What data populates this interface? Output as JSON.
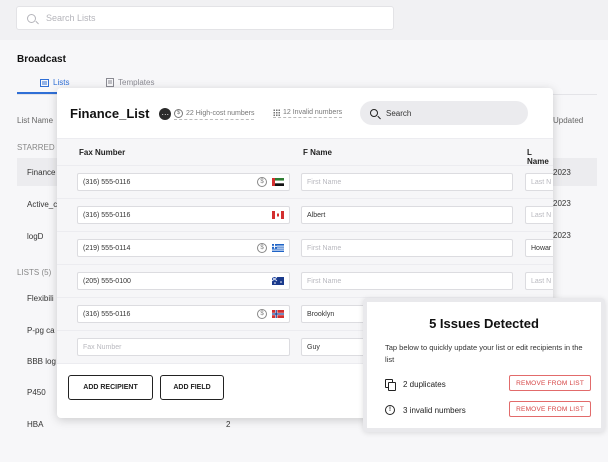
{
  "search": {
    "placeholder": "Search Lists"
  },
  "background": {
    "title": "Broadcast",
    "tabs": [
      {
        "label": "Lists"
      },
      {
        "label": "Templates"
      }
    ],
    "columns": {
      "list_name": "List Name",
      "updated": "Updated"
    },
    "starred_label": "STARRED",
    "lists_label": "LISTS (5)",
    "starred_rows": [
      {
        "name": "Finance",
        "updated": "2023"
      },
      {
        "name": "Active_c",
        "updated": "2023"
      },
      {
        "name": "logD",
        "updated": "2023"
      }
    ],
    "list_rows": [
      {
        "name": "Flexibili",
        "count": "",
        "updated": ""
      },
      {
        "name": "P-pg ca",
        "count": "",
        "updated": ""
      },
      {
        "name": "BBB log",
        "count": "",
        "updated": ""
      },
      {
        "name": "P450",
        "count": "",
        "updated": ""
      },
      {
        "name": "HBA",
        "count": "2",
        "updated": ""
      }
    ]
  },
  "modal": {
    "title": "Finance_List",
    "menu_icon": "…",
    "high_cost": "22 High-cost numbers",
    "invalid": "12 Invalid numbers",
    "search_placeholder": "Search",
    "columns": {
      "fax": "Fax Number",
      "fname": "F Name",
      "lname": "L Name"
    },
    "rows": [
      {
        "fax": "(316) 555-0116",
        "fax_ph": false,
        "fname": "First Name",
        "fname_ph": true,
        "lname": "Last N",
        "lname_ph": true,
        "coin": true,
        "flag": "uae"
      },
      {
        "fax": "(316) 555-0116",
        "fax_ph": false,
        "fname": "Albert",
        "fname_ph": false,
        "lname": "Last N",
        "lname_ph": true,
        "coin": false,
        "flag": "canada"
      },
      {
        "fax": "(219) 555-0114",
        "fax_ph": false,
        "fname": "First Name",
        "fname_ph": true,
        "lname": "Howar",
        "lname_ph": false,
        "coin": true,
        "flag": "greece"
      },
      {
        "fax": "(205) 555-0100",
        "fax_ph": false,
        "fname": "First Name",
        "fname_ph": true,
        "lname": "Last N",
        "lname_ph": true,
        "coin": false,
        "flag": "australia"
      },
      {
        "fax": "(316) 555-0116",
        "fax_ph": false,
        "fname": "Brooklyn",
        "fname_ph": false,
        "lname": "",
        "lname_ph": true,
        "coin": true,
        "flag": "norway"
      },
      {
        "fax": "Fax Number",
        "fax_ph": true,
        "fname": "Guy",
        "fname_ph": false,
        "lname": "",
        "lname_ph": true,
        "coin": false,
        "flag": ""
      }
    ],
    "add_recipient": "ADD RECIPIENT",
    "add_field": "ADD FIELD"
  },
  "issues": {
    "title": "5 Issues Detected",
    "description": "Tap below to quickly update your list or edit recipients in the list",
    "items": [
      {
        "label": "2 duplicates",
        "action": "REMOVE FROM LIST",
        "icon": "copy-icon"
      },
      {
        "label": "3 invalid numbers",
        "action": "REMOVE FROM LIST",
        "icon": "info-icon"
      }
    ]
  },
  "colors": {
    "accent": "#2f6fd6",
    "danger": "#d64545"
  }
}
